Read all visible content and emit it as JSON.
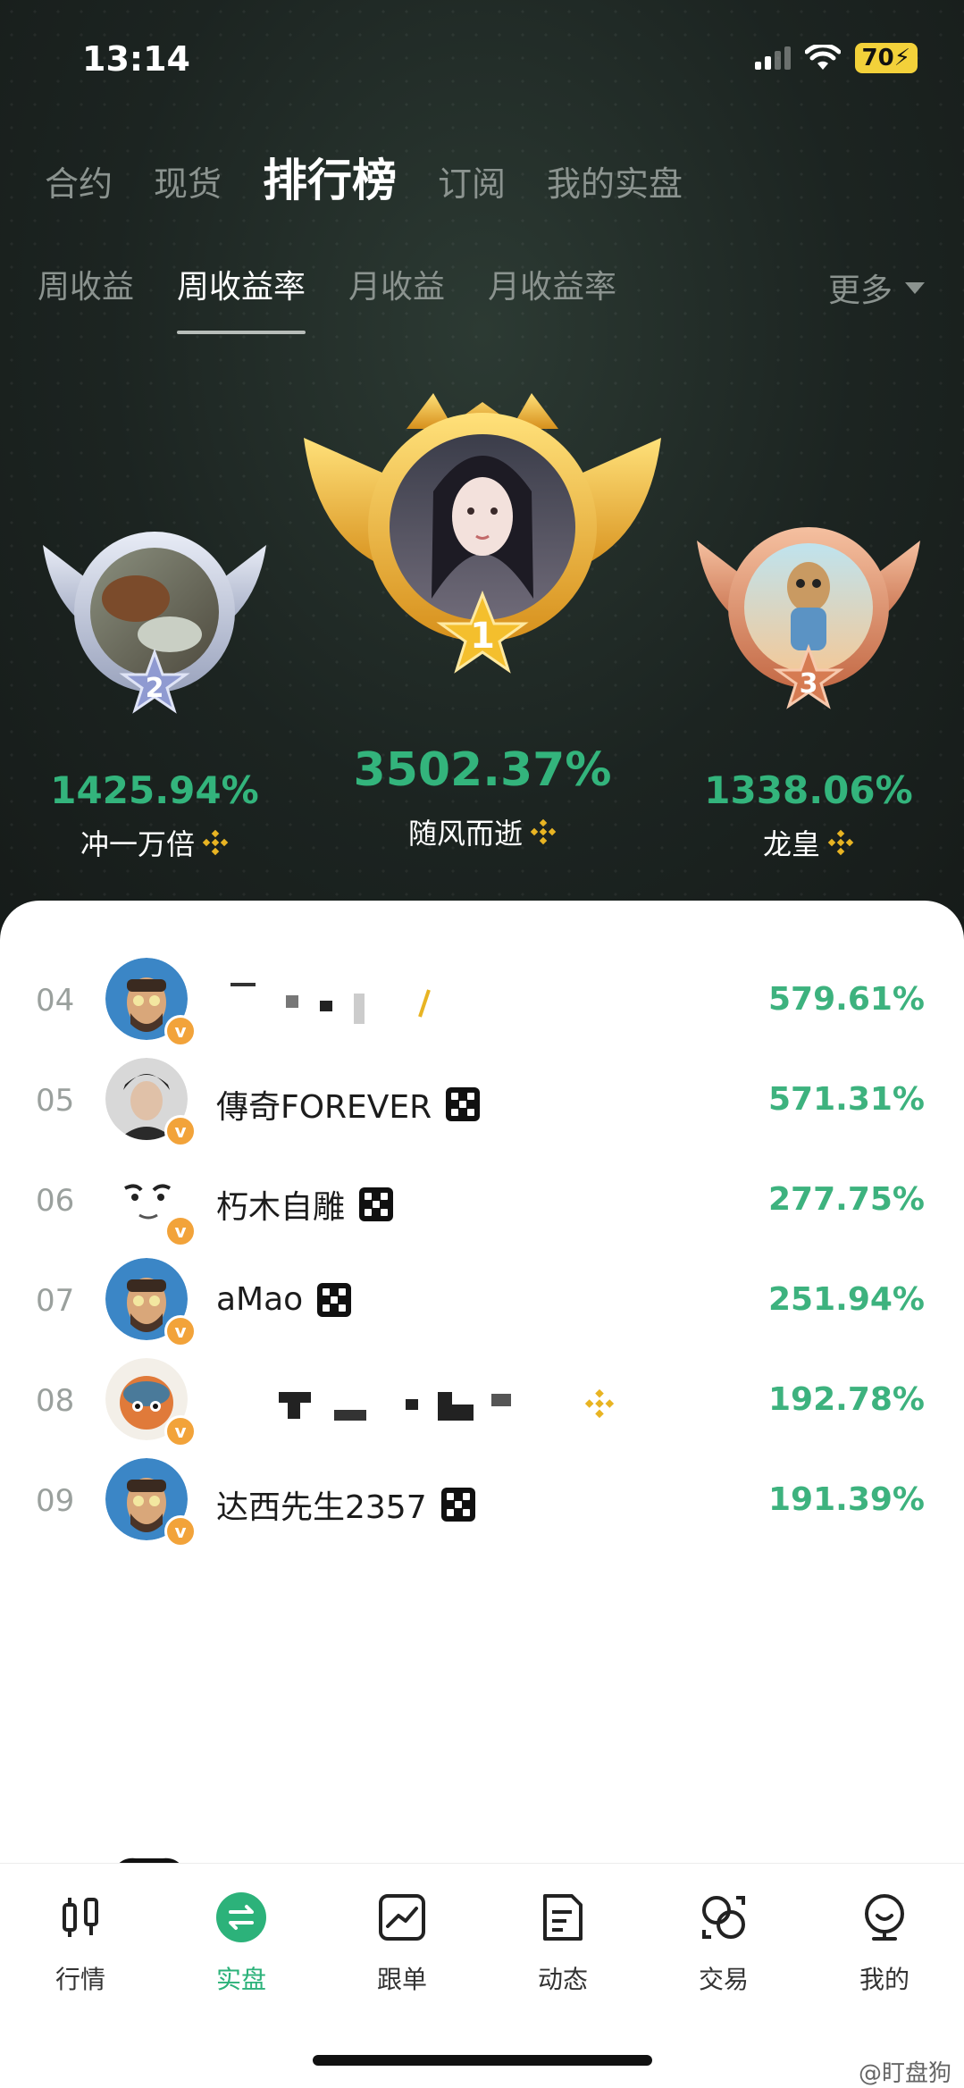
{
  "status": {
    "time": "13:14",
    "battery": "70"
  },
  "tabs_main": [
    "合约",
    "现货",
    "排行榜",
    "订阅",
    "我的实盘"
  ],
  "tabs_main_active": 2,
  "tabs_sub": [
    "周收益",
    "周收益率",
    "月收益",
    "月收益率"
  ],
  "tabs_sub_active": 1,
  "more_label": "更多",
  "podium": {
    "first": {
      "rank": "1",
      "pct": "3502.37%",
      "name": "随风而逝"
    },
    "second": {
      "rank": "2",
      "pct": "1425.94%",
      "name": "冲一万倍"
    },
    "third": {
      "rank": "3",
      "pct": "1338.06%",
      "name": "龙皇"
    }
  },
  "rows": [
    {
      "rank": "04",
      "name": "",
      "pct": "579.61%",
      "badge": "binance"
    },
    {
      "rank": "05",
      "name": "傳奇FOREVER",
      "pct": "571.31%",
      "badge": "dice"
    },
    {
      "rank": "06",
      "name": "朽木自雕",
      "pct": "277.75%",
      "badge": "dice"
    },
    {
      "rank": "07",
      "name": "aMao",
      "pct": "251.94%",
      "badge": "dice"
    },
    {
      "rank": "08",
      "name": "",
      "pct": "192.78%",
      "badge": "binance"
    },
    {
      "rank": "09",
      "name": "达西先生2357",
      "pct": "191.39%",
      "badge": "dice"
    }
  ],
  "vip_badge": "v",
  "nav": [
    "行情",
    "实盘",
    "跟单",
    "动态",
    "交易",
    "我的"
  ],
  "nav_active": 1,
  "watermark": "@盯盘狗",
  "colors": {
    "accent_green": "#2cb27a",
    "gold": "#e9b52c",
    "silver": "#b9c0d4",
    "bronze": "#d98a63"
  }
}
